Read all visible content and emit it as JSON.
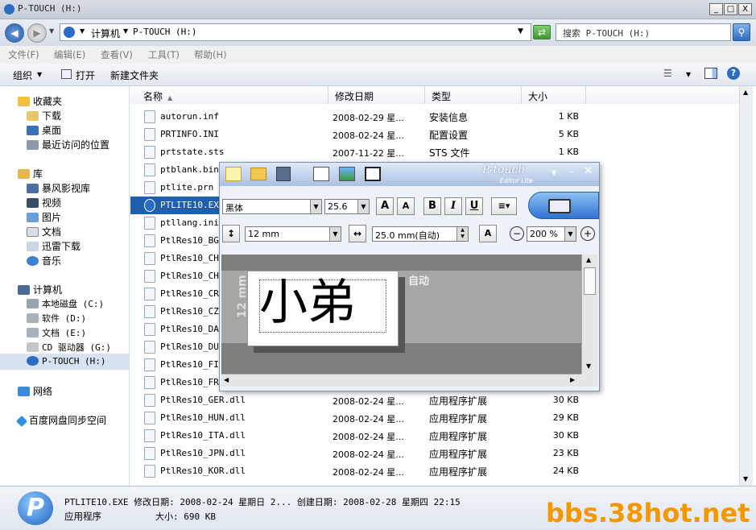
{
  "window": {
    "title": "P-TOUCH (H:)",
    "btn_min": "_",
    "btn_max": "□",
    "btn_close": "X"
  },
  "address": {
    "seg1": "计算机",
    "seg2": "P-TOUCH (H:)",
    "search_placeholder": "搜索 P-TOUCH (H:)"
  },
  "menu": [
    "文件(F)",
    "编辑(E)",
    "查看(V)",
    "工具(T)",
    "帮助(H)"
  ],
  "toolbar": {
    "organize": "组织",
    "open": "打开",
    "new_folder": "新建文件夹"
  },
  "nav": {
    "favorites": "收藏夹",
    "fav_items": [
      "下载",
      "桌面",
      "最近访问的位置"
    ],
    "libraries": "库",
    "lib_items": [
      "暴风影视库",
      "视频",
      "图片",
      "文档",
      "迅雷下载",
      "音乐"
    ],
    "computer": "计算机",
    "drives": [
      "本地磁盘 (C:)",
      "软件 (D:)",
      "文档 (E:)",
      "CD 驱动器 (G:)",
      "P-TOUCH (H:)"
    ],
    "network": "网络",
    "baidu": "百度网盘同步空间"
  },
  "columns": {
    "name": "名称",
    "date": "修改日期",
    "type": "类型",
    "size": "大小"
  },
  "files": [
    {
      "name": "autorun.inf",
      "date": "2008-02-29 星...",
      "type": "安装信息",
      "size": "1 KB"
    },
    {
      "name": "PRTINFO.INI",
      "date": "2008-02-24 星...",
      "type": "配置设置",
      "size": "5 KB"
    },
    {
      "name": "prtstate.sts",
      "date": "2007-11-22 星...",
      "type": "STS 文件",
      "size": "1 KB"
    },
    {
      "name": "ptblank.bin",
      "date": "",
      "type": "",
      "size": ""
    },
    {
      "name": "ptlite.prn",
      "date": "",
      "type": "",
      "size": ""
    },
    {
      "name": "PTLITE10.EXE",
      "date": "",
      "type": "",
      "size": ""
    },
    {
      "name": "ptllang.ini",
      "date": "",
      "type": "",
      "size": ""
    },
    {
      "name": "PtlRes10_BGR",
      "date": "",
      "type": "",
      "size": ""
    },
    {
      "name": "PtlRes10_CHS",
      "date": "",
      "type": "",
      "size": ""
    },
    {
      "name": "PtlRes10_CHT",
      "date": "",
      "type": "",
      "size": ""
    },
    {
      "name": "PtlRes10_CRO",
      "date": "",
      "type": "",
      "size": ""
    },
    {
      "name": "PtlRes10_CZE",
      "date": "",
      "type": "",
      "size": ""
    },
    {
      "name": "PtlRes10_DAN",
      "date": "",
      "type": "",
      "size": ""
    },
    {
      "name": "PtlRes10_DUT",
      "date": "",
      "type": "",
      "size": ""
    },
    {
      "name": "PtlRes10_FIN",
      "date": "",
      "type": "",
      "size": ""
    },
    {
      "name": "PtlRes10_FRA",
      "date": "",
      "type": "",
      "size": ""
    },
    {
      "name": "PtlRes10_GER.dll",
      "date": "2008-02-24 星...",
      "type": "应用程序扩展",
      "size": "30 KB"
    },
    {
      "name": "PtlRes10_HUN.dll",
      "date": "2008-02-24 星...",
      "type": "应用程序扩展",
      "size": "29 KB"
    },
    {
      "name": "PtlRes10_ITA.dll",
      "date": "2008-02-24 星...",
      "type": "应用程序扩展",
      "size": "30 KB"
    },
    {
      "name": "PtlRes10_JPN.dll",
      "date": "2008-02-24 星...",
      "type": "应用程序扩展",
      "size": "23 KB"
    },
    {
      "name": "PtlRes10_KOR.dll",
      "date": "2008-02-24 星...",
      "type": "应用程序扩展",
      "size": "24 KB"
    }
  ],
  "status": {
    "line1": "PTLITE10.EXE  修改日期: 2008-02-24 星期日 2...  创建日期: 2008-02-28 星期四 22:15",
    "line2_type": "应用程序",
    "line2_size": "大小: 690 KB",
    "watermark": "bbs.38hot.net"
  },
  "ptouch": {
    "brand": "P-touch",
    "brand_sub": "Editor Lite",
    "font": "黑体",
    "font_size": "25.6",
    "bold": "B",
    "italic": "I",
    "underline": "U",
    "tape": "12 mm",
    "length": "25.0 mm(自动)",
    "zoom": "200 %",
    "label_text": "小弟",
    "auto": "自动",
    "ruler": "12 mm"
  },
  "colors": {
    "selected_row": "#1f5fae",
    "accent": "#3d76c9",
    "watermark": "#f39800"
  }
}
